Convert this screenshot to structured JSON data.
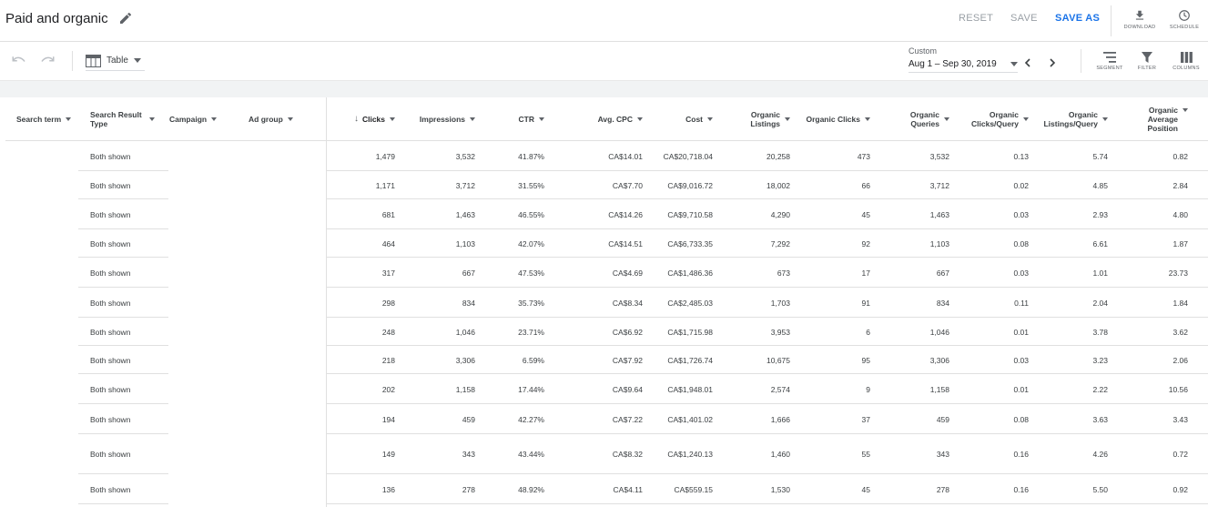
{
  "header": {
    "title": "Paid and organic",
    "reset_label": "RESET",
    "save_label": "SAVE",
    "save_as_label": "SAVE AS",
    "download_label": "DOWNLOAD",
    "schedule_label": "SCHEDULE"
  },
  "toolbar": {
    "view_label": "Table",
    "date_label": "Custom",
    "date_range": "Aug 1 – Sep 30, 2019",
    "segment_label": "SEGMENT",
    "filter_label": "FILTER",
    "columns_label": "COLUMNS"
  },
  "colors": {
    "accent": "#1a73e8",
    "disabled": "#9aa0a6",
    "divider": "#e0e0e0",
    "band": "#f1f3f4"
  },
  "table": {
    "columns": [
      {
        "label": "Search term"
      },
      {
        "label": "Search Result Type"
      },
      {
        "label": "Campaign"
      },
      {
        "label": "Ad group"
      },
      {
        "label": "Clicks",
        "sorted": "descending"
      },
      {
        "label": "Impressions"
      },
      {
        "label": "CTR"
      },
      {
        "label": "Avg. CPC"
      },
      {
        "label": "Cost"
      },
      {
        "label": "Organic Listings"
      },
      {
        "label": "Organic Clicks"
      },
      {
        "label": "Organic Queries"
      },
      {
        "label": "Organic Clicks/Query"
      },
      {
        "label": "Organic Listings/Query"
      },
      {
        "label": "Organic Average Position"
      }
    ],
    "rows": [
      {
        "type": "Both shown",
        "clicks": "1,479",
        "impressions": "3,532",
        "ctr": "41.87%",
        "cpc": "CA$14.01",
        "cost": "CA$20,718.04",
        "listings": "20,258",
        "oclicks": "473",
        "queries": "3,532",
        "cpq": "0.13",
        "lpq": "5.74",
        "pos": "0.82"
      },
      {
        "type": "Both shown",
        "clicks": "1,171",
        "impressions": "3,712",
        "ctr": "31.55%",
        "cpc": "CA$7.70",
        "cost": "CA$9,016.72",
        "listings": "18,002",
        "oclicks": "66",
        "queries": "3,712",
        "cpq": "0.02",
        "lpq": "4.85",
        "pos": "2.84"
      },
      {
        "type": "Both shown",
        "clicks": "681",
        "impressions": "1,463",
        "ctr": "46.55%",
        "cpc": "CA$14.26",
        "cost": "CA$9,710.58",
        "listings": "4,290",
        "oclicks": "45",
        "queries": "1,463",
        "cpq": "0.03",
        "lpq": "2.93",
        "pos": "4.80"
      },
      {
        "type": "Both shown",
        "clicks": "464",
        "impressions": "1,103",
        "ctr": "42.07%",
        "cpc": "CA$14.51",
        "cost": "CA$6,733.35",
        "listings": "7,292",
        "oclicks": "92",
        "queries": "1,103",
        "cpq": "0.08",
        "lpq": "6.61",
        "pos": "1.87"
      },
      {
        "type": "Both shown",
        "clicks": "317",
        "impressions": "667",
        "ctr": "47.53%",
        "cpc": "CA$4.69",
        "cost": "CA$1,486.36",
        "listings": "673",
        "oclicks": "17",
        "queries": "667",
        "cpq": "0.03",
        "lpq": "1.01",
        "pos": "23.73"
      },
      {
        "type": "Both shown",
        "clicks": "298",
        "impressions": "834",
        "ctr": "35.73%",
        "cpc": "CA$8.34",
        "cost": "CA$2,485.03",
        "listings": "1,703",
        "oclicks": "91",
        "queries": "834",
        "cpq": "0.11",
        "lpq": "2.04",
        "pos": "1.84"
      },
      {
        "type": "Both shown",
        "clicks": "248",
        "impressions": "1,046",
        "ctr": "23.71%",
        "cpc": "CA$6.92",
        "cost": "CA$1,715.98",
        "listings": "3,953",
        "oclicks": "6",
        "queries": "1,046",
        "cpq": "0.01",
        "lpq": "3.78",
        "pos": "3.62"
      },
      {
        "type": "Both shown",
        "clicks": "218",
        "impressions": "3,306",
        "ctr": "6.59%",
        "cpc": "CA$7.92",
        "cost": "CA$1,726.74",
        "listings": "10,675",
        "oclicks": "95",
        "queries": "3,306",
        "cpq": "0.03",
        "lpq": "3.23",
        "pos": "2.06"
      },
      {
        "type": "Both shown",
        "clicks": "202",
        "impressions": "1,158",
        "ctr": "17.44%",
        "cpc": "CA$9.64",
        "cost": "CA$1,948.01",
        "listings": "2,574",
        "oclicks": "9",
        "queries": "1,158",
        "cpq": "0.01",
        "lpq": "2.22",
        "pos": "10.56"
      },
      {
        "type": "Both shown",
        "clicks": "194",
        "impressions": "459",
        "ctr": "42.27%",
        "cpc": "CA$7.22",
        "cost": "CA$1,401.02",
        "listings": "1,666",
        "oclicks": "37",
        "queries": "459",
        "cpq": "0.08",
        "lpq": "3.63",
        "pos": "3.43"
      },
      {
        "type": "Both shown",
        "clicks": "149",
        "impressions": "343",
        "ctr": "43.44%",
        "cpc": "CA$8.32",
        "cost": "CA$1,240.13",
        "listings": "1,460",
        "oclicks": "55",
        "queries": "343",
        "cpq": "0.16",
        "lpq": "4.26",
        "pos": "0.72"
      },
      {
        "type": "Both shown",
        "clicks": "136",
        "impressions": "278",
        "ctr": "48.92%",
        "cpc": "CA$4.11",
        "cost": "CA$559.15",
        "listings": "1,530",
        "oclicks": "45",
        "queries": "278",
        "cpq": "0.16",
        "lpq": "5.50",
        "pos": "0.92"
      }
    ]
  }
}
